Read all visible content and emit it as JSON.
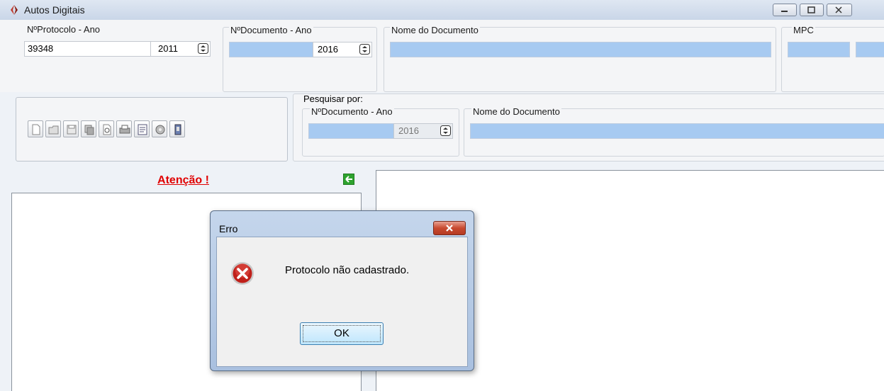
{
  "window": {
    "title": "Autos Digitais",
    "colors": {
      "field_blue": "#a7caf1",
      "attention_red": "#e00000"
    }
  },
  "protocolo": {
    "label": "NºProtocolo - Ano",
    "number": "39348",
    "year": "2011"
  },
  "documento": {
    "label": "NºDocumento - Ano",
    "number": "",
    "year": "2016"
  },
  "nome_documento": {
    "label": "Nome do Documento",
    "value": ""
  },
  "mpc": {
    "label": "MPC",
    "value1": "",
    "value2": ""
  },
  "toolbar": {
    "icons": [
      "new-document-icon",
      "open-folder-icon",
      "save-icon",
      "copy-icon",
      "print-preview-icon",
      "print-icon",
      "form-icon",
      "tools-icon",
      "scanner-icon"
    ]
  },
  "search": {
    "label": "Pesquisar por:",
    "documento_label": "NºDocumento - Ano",
    "documento_number": "",
    "documento_year": "2016",
    "nome_label": "Nome do Documento",
    "nome_value": ""
  },
  "left_pane": {
    "attention": "Atenção !",
    "back_icon": "back-arrow-icon"
  },
  "dialog": {
    "title": "Erro",
    "message": "Protocolo não cadastrado.",
    "ok_label": "OK",
    "icon": "error-icon"
  }
}
